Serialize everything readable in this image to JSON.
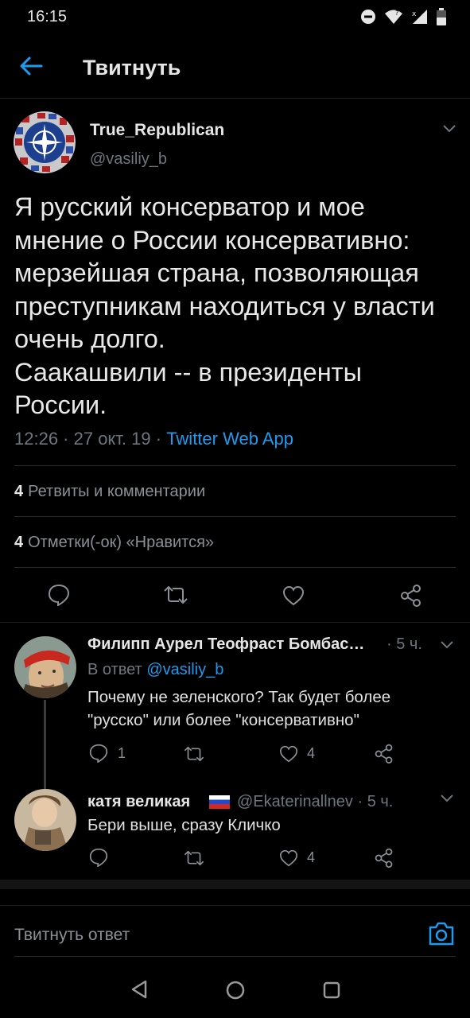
{
  "status_bar": {
    "time": "16:15"
  },
  "header": {
    "title": "Твитнуть"
  },
  "tweet": {
    "author_name": "True_Republican",
    "author_handle": "@vasiliy_b",
    "text": "Я русский консерватор и мое мнение о России консервативно: мерзейшая страна, позволяющая преступникам находиться у власти очень долго.\nСаакашвили -- в президенты России.",
    "time": "12:26 · 27 окт. 19 · ",
    "source": "Twitter Web App",
    "retweets_count": "4",
    "retweets_label": "Ретвиты и комментарии",
    "likes_count": "4",
    "likes_label": "Отметки(-ок) «Нравится»"
  },
  "replies": [
    {
      "name": "Филипп Аурел Теофраст Бомбас…",
      "time": " · 5 ч.",
      "reply_to_prefix": "В ответ ",
      "reply_to_handle": "@vasiliy_b",
      "text": "Почему не зеленского? Так будет более \"русско\" или более \"консервативно\"",
      "comments": "1",
      "retweets": "",
      "likes": "4"
    },
    {
      "name": "катя великая",
      "flag": "russia-flag",
      "handle": "@Ekaterinallnev",
      "time": " · 5 ч.",
      "text": "Бери выше, сразу Кличко",
      "comments": "",
      "retweets": "",
      "likes": "4"
    }
  ],
  "compose": {
    "placeholder": "Твитнуть ответ"
  },
  "colors": {
    "background": "#000000",
    "accent": "#1d9bf0",
    "muted": "#6e767d"
  }
}
